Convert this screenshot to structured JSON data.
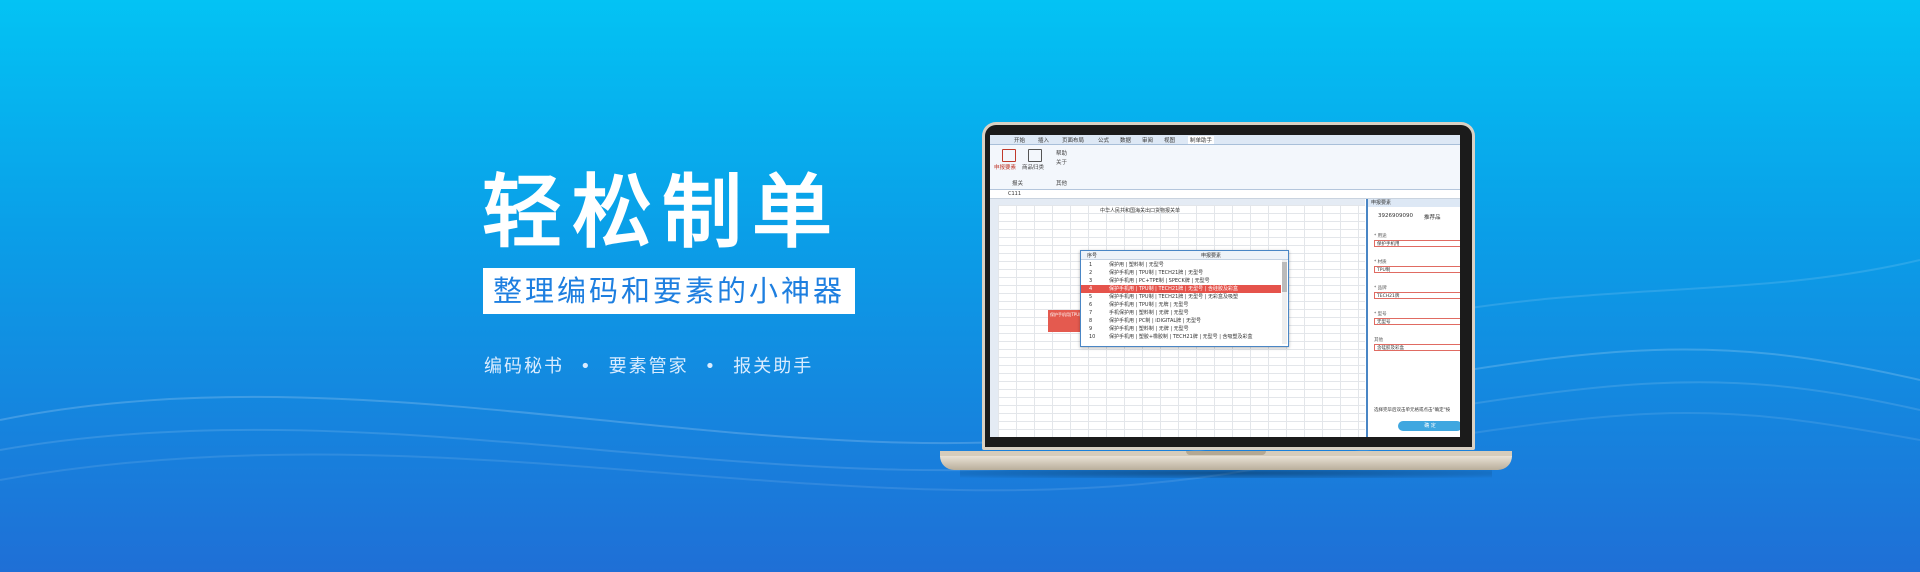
{
  "hero": {
    "title": "轻松制单",
    "subtitle": "整理编码和要素的小神器",
    "tags": [
      "编码秘书",
      "要素管家",
      "报关助手"
    ],
    "separator": "•"
  },
  "app": {
    "menu_tabs": [
      "开始",
      "插入",
      "页面布局",
      "公式",
      "数据",
      "审阅",
      "视图",
      "制单助手"
    ],
    "ribbon": {
      "declare_button": "申报要素",
      "product_button": "商品归类",
      "help_label": "帮助",
      "about_label": "关于",
      "group_left": "报关",
      "group_right": "其他"
    },
    "name_box": "C111",
    "sheet_title": "中华人民共和国海关出口货物报关单",
    "dropdown": {
      "headers": [
        "序号",
        "申报要素"
      ],
      "rows": [
        {
          "n": "1",
          "t": "保护用 | 塑料制 | 无型号"
        },
        {
          "n": "2",
          "t": "保护手机用 | TPU制 | TECH21牌 | 无型号"
        },
        {
          "n": "3",
          "t": "保护手机用 | PC+TPE制 | SPECK牌 | 无型号"
        },
        {
          "n": "4",
          "t": "保护手机用 | TPU制 | TECH21牌 | 无型号 | 含硅胶及彩盒"
        },
        {
          "n": "5",
          "t": "保护手机用 | TPU制 | TECH21牌 | 无型号 | 无彩盒及吸塑"
        },
        {
          "n": "6",
          "t": "保护手机用 | TPU制 | 无牌 | 无型号"
        },
        {
          "n": "7",
          "t": "手机保护用 | 塑料制 | 无牌 | 无型号"
        },
        {
          "n": "8",
          "t": "保护手机用 | PC制 | iDIGITAL牌 | 无型号"
        },
        {
          "n": "9",
          "t": "保护手机用 | 塑料制 | 无牌 | 无型号"
        },
        {
          "n": "10",
          "t": "保护手机用 | 塑胶+橡胶制 | TECH21牌 | 无型号 | 含吸塑及彩盒"
        }
      ],
      "selected_index": 3
    },
    "selected_cell_text": "保护手机用|TPU制|TECH21牌|无型号|含硅胶及彩盒",
    "side_panel": {
      "title": "申报要素",
      "code": "3926909090",
      "recommend": "推荐品",
      "fields": [
        {
          "label": "* 用途",
          "value": "保护手机用"
        },
        {
          "label": "* 材质",
          "value": "TPU制"
        },
        {
          "label": "* 品牌",
          "value": "TECH21牌"
        },
        {
          "label": "* 型号",
          "value": "无型号"
        },
        {
          "label": "其他",
          "value": "含硅胶及彩盒"
        }
      ],
      "hint": "选择完毕后双击单元格或点击\"确定\"按",
      "confirm": "确 定"
    }
  },
  "colors": {
    "bg_top": "#03c3f4",
    "bg_bottom": "#1f6fd6",
    "accent": "#e5534b",
    "subtitle_text": "#1e7fe0"
  }
}
